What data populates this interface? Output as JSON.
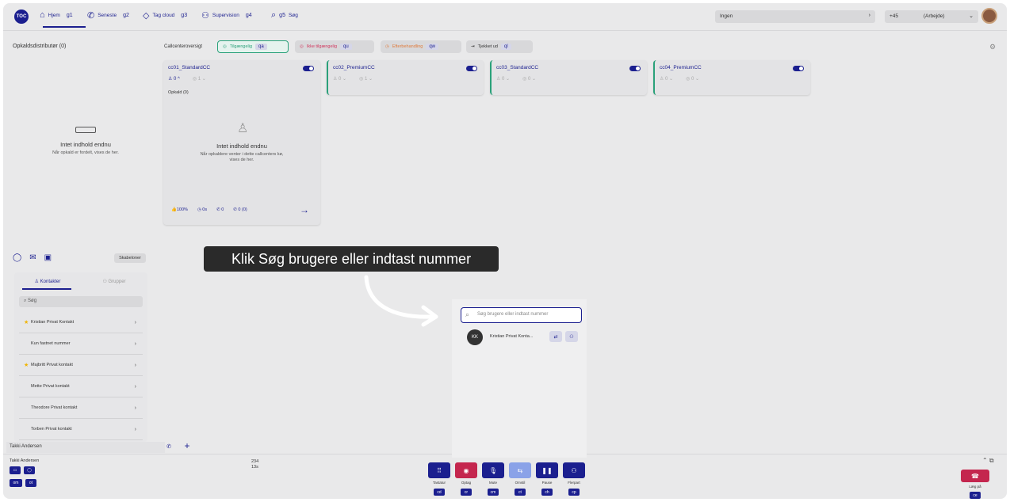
{
  "topbar": {
    "logo": "TOC",
    "nav": [
      {
        "label": "Hjem",
        "key": "g1"
      },
      {
        "label": "Seneste",
        "key": "g2"
      },
      {
        "label": "Tag cloud",
        "key": "g3"
      },
      {
        "label": "Supervision",
        "key": "g4"
      },
      {
        "label": "Søg",
        "key": "g5"
      }
    ],
    "status_select": "Ingen",
    "phone_prefix": "+45",
    "phone_type": "(Arbejde)"
  },
  "left_panel": {
    "title": "Opkaldsdistributør (0)",
    "empty_title": "Intet indhold endnu",
    "empty_sub": "Når opkald er fordelt, vises de her."
  },
  "callcenter": {
    "title": "Callcenteroversigt",
    "chips": [
      {
        "label": "Tilgængelig",
        "key": "qa"
      },
      {
        "label": "Ikke tilgængelig",
        "key": "qu"
      },
      {
        "label": "Efterbehandling",
        "key": "qw"
      },
      {
        "label": "Tjekket ud",
        "key": "ql"
      }
    ],
    "cards": [
      {
        "name": "cc01_StandardCC",
        "agents": "0",
        "queue": "1"
      },
      {
        "name": "cc02_PremiumCC",
        "agents": "0",
        "queue": "1"
      },
      {
        "name": "cc03_StandardCC",
        "agents": "0",
        "queue": "0"
      },
      {
        "name": "cc04_PremiumCC",
        "agents": "0",
        "queue": "0"
      }
    ],
    "first_card": {
      "calls": "Opkald (0)",
      "empty_title": "Intet indhold endnu",
      "empty_sub": "Når opkaldere venter i dette callcenters kø, vises de her.",
      "stats": [
        "100%",
        "0s",
        "0",
        "0 (0)"
      ]
    }
  },
  "contacts": {
    "templates": "Skabeloner",
    "tabs": [
      "Kontakter",
      "Grupper"
    ],
    "search_placeholder": "Søg",
    "items": [
      {
        "name": "Kristian Privat Kontakt",
        "star": "★"
      },
      {
        "name": "Kun fastnet nummer",
        "star": ""
      },
      {
        "name": "Majbritt Privat kontakt",
        "star": "★"
      },
      {
        "name": "Mette Privat kontakt",
        "star": ""
      },
      {
        "name": "Theodore Privat kontakt",
        "star": ""
      },
      {
        "name": "Torben Privat kontakt",
        "star": ""
      }
    ]
  },
  "active_user": "Takki Andersen",
  "footer": {
    "user": "Takki Andersen",
    "keys_left": [
      "om",
      "ot"
    ],
    "number": "234",
    "timer": "13s",
    "controls": [
      {
        "label": "Tastatur",
        "key": "cd",
        "color": "#1b1f8f"
      },
      {
        "label": "Optag",
        "key": "cr",
        "color": "#c4264e"
      },
      {
        "label": "Mute",
        "key": "cm",
        "color": "#1b1f8f"
      },
      {
        "label": "Omstil",
        "key": "ct",
        "color": "#8aa2e8"
      },
      {
        "label": "Pause",
        "key": "ch",
        "color": "#1b1f8f"
      },
      {
        "label": "Flerpart",
        "key": "cp",
        "color": "#1b1f8f"
      }
    ],
    "hangup_label": "Læg på",
    "hangup_key": "ce"
  },
  "popup": {
    "search_placeholder": "Søg brugere eller indtast nummer",
    "result_initials": "KK",
    "result_name": "Kristian Privat Konta..."
  },
  "tooltip": "Klik Søg brugere eller indtast nummer"
}
